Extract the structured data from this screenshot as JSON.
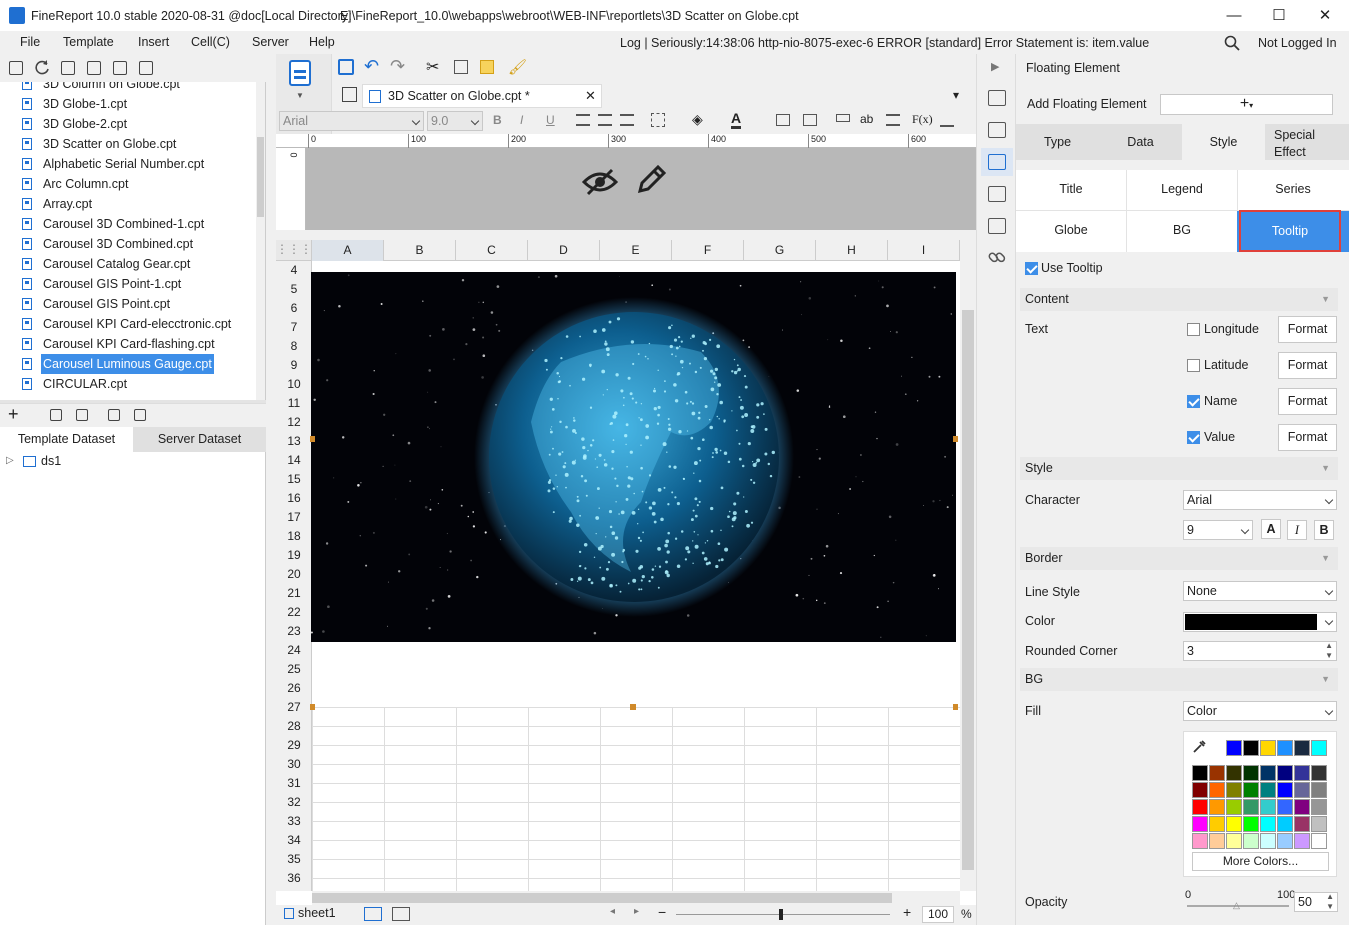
{
  "window": {
    "title": "FineReport 10.0 stable 2020-08-31 @doc[Local Directory]",
    "path": "E:\\FineReport_10.0\\webapps\\webroot\\WEB-INF\\reportlets\\3D Scatter on Globe.cpt",
    "min": "—",
    "max": "☐",
    "close": "✕"
  },
  "menu": {
    "items": [
      "File",
      "Template",
      "Insert",
      "Cell(C)",
      "Server",
      "Help"
    ],
    "log": "Log | Seriously:14:38:06 http-nio-8075-exec-6 ERROR [standard] Error Statement is: item.value",
    "login": "Not Logged In"
  },
  "files": [
    "3D Column on Globe.cpt",
    "3D Globe-1.cpt",
    "3D Globe-2.cpt",
    "3D Scatter on Globe.cpt",
    "Alphabetic Serial Number.cpt",
    "Arc Column.cpt",
    "Array.cpt",
    "Carousel 3D Combined-1.cpt",
    "Carousel 3D Combined.cpt",
    "Carousel Catalog Gear.cpt",
    "Carousel GIS Point-1.cpt",
    "Carousel GIS Point.cpt",
    "Carousel KPI Card-elecctronic.cpt",
    "Carousel KPI Card-flashing.cpt",
    "Carousel Luminous Gauge.cpt",
    "CIRCULAR.cpt"
  ],
  "dataset": {
    "tab_template": "Template Dataset",
    "tab_server": "Server Dataset",
    "item": "ds1"
  },
  "editor": {
    "tab": "3D Scatter on Globe.cpt *",
    "font": "Arial",
    "size": "9.0",
    "ruler": [
      "0",
      "100",
      "200",
      "300",
      "400",
      "500",
      "600"
    ],
    "cols": [
      "A",
      "B",
      "C",
      "D",
      "E",
      "F",
      "G",
      "H",
      "I"
    ],
    "rows": [
      "4",
      "5",
      "6",
      "7",
      "8",
      "9",
      "10",
      "11",
      "12",
      "13",
      "14",
      "15",
      "16",
      "17",
      "18",
      "19",
      "20",
      "21",
      "22",
      "23",
      "24",
      "25",
      "26",
      "27",
      "28",
      "29",
      "30",
      "31",
      "32",
      "33",
      "34",
      "35",
      "36"
    ],
    "sheet": "sheet1",
    "zoom": "100",
    "zoom_unit": "%"
  },
  "panel": {
    "title": "Floating Element",
    "add_label": "Add Floating Element",
    "tabs": [
      "Type",
      "Data",
      "Style",
      "Special Effect"
    ],
    "subtabs": [
      "Title",
      "Legend",
      "Series",
      "Globe",
      "BG",
      "Tooltip"
    ],
    "use_tooltip": "Use Tooltip",
    "content": "Content",
    "text": "Text",
    "longitude": "Longitude",
    "latitude": "Latitude",
    "name": "Name",
    "value": "Value",
    "format": "Format",
    "style": "Style",
    "character": "Character",
    "font": "Arial",
    "size": "9",
    "bold": "A",
    "italic": "I",
    "b": "B",
    "border": "Border",
    "line_style": "Line Style",
    "line_style_val": "None",
    "color": "Color",
    "rounded": "Rounded Corner",
    "rounded_val": "3",
    "bg": "BG",
    "fill": "Fill",
    "fill_val": "Color",
    "more_colors": "More Colors...",
    "opacity": "Opacity",
    "op_min": "0",
    "op_max": "100",
    "op_val": "50"
  },
  "palette_top": [
    "#0000ff",
    "#000000",
    "#ffd700",
    "#1e90ff",
    "#1a2a40",
    "#00ffff"
  ],
  "palette": [
    "#000000",
    "#993300",
    "#333300",
    "#003300",
    "#003366",
    "#000080",
    "#333399",
    "#333333",
    "#800000",
    "#ff6600",
    "#808000",
    "#008000",
    "#008080",
    "#0000ff",
    "#666699",
    "#808080",
    "#ff0000",
    "#ff9900",
    "#99cc00",
    "#339966",
    "#33cccc",
    "#3366ff",
    "#800080",
    "#969696",
    "#ff00ff",
    "#ffcc00",
    "#ffff00",
    "#00ff00",
    "#00ffff",
    "#00ccff",
    "#993366",
    "#c0c0c0",
    "#ff99cc",
    "#ffcc99",
    "#ffff99",
    "#ccffcc",
    "#ccffff",
    "#99ccff",
    "#cc99ff",
    "#ffffff"
  ]
}
